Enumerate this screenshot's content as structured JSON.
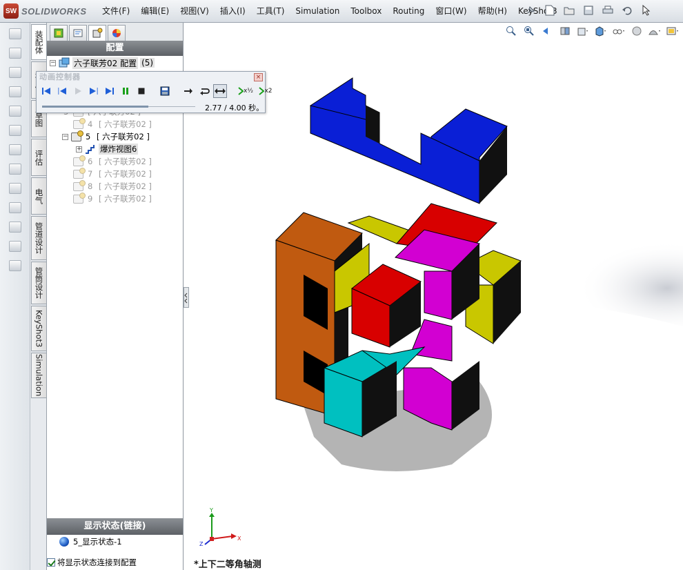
{
  "app": {
    "logo_badge": "SW",
    "logo_text": "SOLIDWORKS"
  },
  "menu": [
    "文件(F)",
    "编辑(E)",
    "视图(V)",
    "插入(I)",
    "工具(T)",
    "Simulation",
    "Toolbox",
    "Routing",
    "窗口(W)",
    "帮助(H)",
    "KeyShot3"
  ],
  "vertical_tabs": [
    "装配体",
    "布局",
    "草图",
    "评估",
    "电气",
    "管道设计",
    "管筒设计",
    "KeyShot3",
    "Simulation"
  ],
  "panel": {
    "title": "配置",
    "root": {
      "label": "六子联芳02 配置",
      "count": "(5)"
    },
    "rows": [
      {
        "num": "3",
        "label": "[ 六子联芳02 ]"
      },
      {
        "num": "4",
        "label": "[ 六子联芳02 ]"
      },
      {
        "num": "5",
        "label": "[ 六子联芳02 ]"
      },
      {
        "num": "",
        "label": "爆炸视图6"
      },
      {
        "num": "6",
        "label": "[ 六子联芳02 ]"
      },
      {
        "num": "7",
        "label": "[ 六子联芳02 ]"
      },
      {
        "num": "8",
        "label": "[ 六子联芳02 ]"
      },
      {
        "num": "9",
        "label": "[ 六子联芳02 ]"
      }
    ],
    "display_state_title": "显示状态(链接)",
    "display_state_item": "5_显示状态-1",
    "link_checkbox": "将显示状态连接到配置"
  },
  "animation": {
    "title": "动画控制器",
    "close": "×",
    "time_text": "2.77 / 4.00 秒。",
    "progress": 0.6925,
    "speed_half": "x½",
    "speed_double": "x2"
  },
  "viewport": {
    "view_name": "*上下二等角轴测",
    "triad": {
      "x": "X",
      "y": "Y",
      "z": "Z"
    },
    "colors": {
      "blue": "#0a1fd6",
      "red": "#d80000",
      "magenta": "#d200d2",
      "yellow": "#c9c700",
      "orange": "#c05a10",
      "cyan": "#00c0c0",
      "black": "#000000"
    }
  }
}
